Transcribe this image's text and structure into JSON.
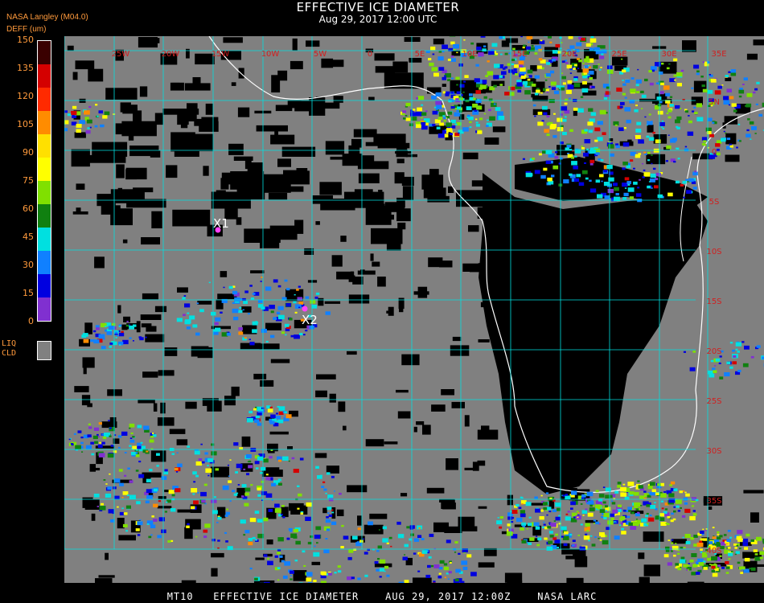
{
  "header": {
    "title": "EFFECTIVE ICE DIAMETER",
    "subtitle": "Aug 29, 2017 12:00 UTC",
    "credit": "NASA Langley (M04.0)",
    "unit": "DEFF (um)"
  },
  "colorbar": {
    "ticks": [
      "150",
      "135",
      "120",
      "105",
      "90",
      "75",
      "60",
      "45",
      "30",
      "15",
      "0"
    ],
    "colors": [
      "#3a0000",
      "#d40000",
      "#ff2a00",
      "#ff8c00",
      "#ffe000",
      "#ffff00",
      "#80e000",
      "#108010",
      "#00e0e0",
      "#1080ff",
      "#0000e0",
      "#8030d0"
    ],
    "liq_label": [
      "LIQ",
      "CLD"
    ],
    "liq_color": "#808080"
  },
  "map": {
    "ocean_clear_color": "#000000",
    "liquid_cloud_color": "#808080",
    "grid_color": "#00e0e0",
    "coast_color": "#ffffff",
    "lon_labels": [
      "25W",
      "20W",
      "15W",
      "10W",
      "5W",
      "0",
      "5E",
      "10E",
      "15E",
      "20E",
      "25E",
      "30E",
      "35E"
    ],
    "lat_labels": [
      "5N",
      "0",
      "5S",
      "10S",
      "15S",
      "20S",
      "25S",
      "30S",
      "35S",
      "40S"
    ],
    "markers": [
      {
        "label": "X1",
        "color": "#ff40ff"
      },
      {
        "label": "X2",
        "color": "#ff40ff"
      }
    ]
  },
  "footer": "MT10   EFFECTIVE ICE DIAMETER    AUG 29, 2017 12:00Z    NASA LARC"
}
